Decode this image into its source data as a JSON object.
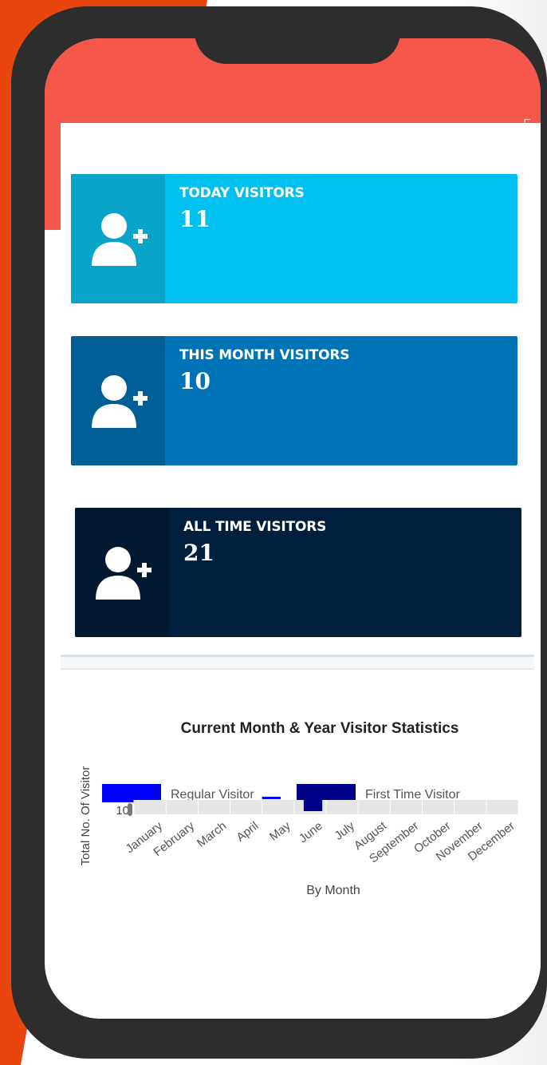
{
  "cards": [
    {
      "label": "TODAY VISITORS",
      "count": "11",
      "icon": "user-add-icon"
    },
    {
      "label": "THIS MONTH VISITORS",
      "count": "10",
      "icon": "user-add-icon"
    },
    {
      "label": "ALL TIME VISITORS",
      "count": "21",
      "icon": "user-add-icon"
    }
  ],
  "colors": {
    "header": "#f5574b",
    "card_today": "#00c0ef",
    "card_month": "#0073b7",
    "card_all": "#001f3f",
    "series_regular": "#0000ff",
    "series_first": "#00008b"
  },
  "chart_data": {
    "type": "bar",
    "title": "Current Month & Year Visitor Statistics",
    "xlabel": "By Month",
    "ylabel": "Total No. Of Visitor",
    "categories": [
      "January",
      "February",
      "March",
      "April",
      "May",
      "June",
      "July",
      "August",
      "September",
      "October",
      "November",
      "December"
    ],
    "series": [
      {
        "name": "Regular Visitor",
        "values": [
          0,
          0,
          0,
          0,
          1,
          0,
          0,
          0,
          0,
          0,
          0,
          0
        ]
      },
      {
        "name": "First Time Visitor",
        "values": [
          0,
          0,
          0,
          0,
          0,
          9,
          0,
          0,
          0,
          0,
          0,
          0
        ]
      }
    ],
    "ytick_label": "10",
    "legend": "top"
  }
}
